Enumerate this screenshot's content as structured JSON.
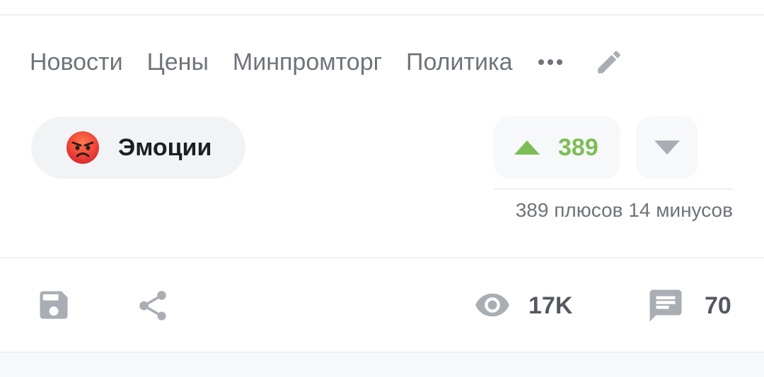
{
  "tags": {
    "items": [
      "Новости",
      "Цены",
      "Минпромторг",
      "Политика"
    ],
    "more_icon": "more-horizontal-icon",
    "edit_icon": "pencil-icon"
  },
  "emotions": {
    "label": "Эмоции",
    "icon": "angry-face-emoji"
  },
  "rating": {
    "upvote_icon": "triangle-up-icon",
    "downvote_icon": "triangle-down-icon",
    "count": "389",
    "summary": "389 плюсов 14 минусов"
  },
  "footer": {
    "save_icon": "floppy-disk-icon",
    "share_icon": "share-icon",
    "views_icon": "eye-icon",
    "views": "17K",
    "comments_icon": "comment-icon",
    "comments": "70"
  },
  "colors": {
    "accent_green": "#7dbd57",
    "icon_gray": "#a9adb4",
    "text_gray": "#6f737a",
    "pill_bg": "#f2f3f5"
  }
}
